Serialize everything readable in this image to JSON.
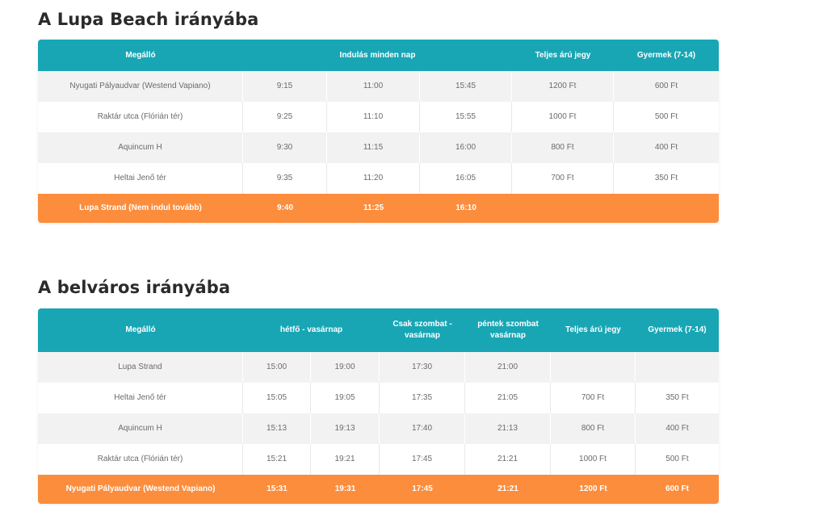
{
  "colors": {
    "header_bg": "#18a6b5",
    "final_row_bg": "#fc8d3c",
    "row_alt_bg": "#f2f2f2",
    "title": "#2b2b2b"
  },
  "to_beach": {
    "title": "A Lupa Beach irányába",
    "headers": {
      "stop": "Megálló",
      "departures": "Indulás minden nap",
      "full_price": "Teljes árú jegy",
      "child": "Gyermek (7-14)"
    },
    "rows": [
      {
        "stop": "Nyugati Pályaudvar (Westend Vapiano)",
        "t1": "9:15",
        "t2": "11:00",
        "t3": "15:45",
        "full": "1200 Ft",
        "child": "600 Ft"
      },
      {
        "stop": "Raktár utca (Flórián tér)",
        "t1": "9:25",
        "t2": "11:10",
        "t3": "15:55",
        "full": "1000 Ft",
        "child": "500 Ft"
      },
      {
        "stop": "Aquincum H",
        "t1": "9:30",
        "t2": "11:15",
        "t3": "16:00",
        "full": "800 Ft",
        "child": "400 Ft"
      },
      {
        "stop": "Heltai Jenő tér",
        "t1": "9:35",
        "t2": "11:20",
        "t3": "16:05",
        "full": "700 Ft",
        "child": "350 Ft"
      }
    ],
    "final": {
      "stop": "Lupa Strand (Nem indul tovább)",
      "t1": "9:40",
      "t2": "11:25",
      "t3": "16:10",
      "full": "",
      "child": ""
    }
  },
  "to_city": {
    "title": "A belváros irányába",
    "headers": {
      "stop": "Megálló",
      "mon_sun": "hétfő - vasárnap",
      "sat_sun_only": "Csak szombat - vasárnap",
      "fri_sat_sun": "péntek szombat vasárnap",
      "full_price": "Teljes árú jegy",
      "child": "Gyermek (7-14)"
    },
    "rows": [
      {
        "stop": "Lupa Strand",
        "t1": "15:00",
        "t2": "19:00",
        "t3": "17:30",
        "t4": "21:00",
        "full": "",
        "child": ""
      },
      {
        "stop": "Heltai Jenő tér",
        "t1": "15:05",
        "t2": "19:05",
        "t3": "17:35",
        "t4": "21:05",
        "full": "700 Ft",
        "child": "350 Ft"
      },
      {
        "stop": "Aquincum H",
        "t1": "15:13",
        "t2": "19:13",
        "t3": "17:40",
        "t4": "21:13",
        "full": "800 Ft",
        "child": "400 Ft"
      },
      {
        "stop": "Raktár utca (Flórián tér)",
        "t1": "15:21",
        "t2": "19:21",
        "t3": "17:45",
        "t4": "21:21",
        "full": "1000 Ft",
        "child": "500 Ft"
      }
    ],
    "final": {
      "stop": "Nyugati Pályaudvar (Westend Vapiano)",
      "t1": "15:31",
      "t2": "19:31",
      "t3": "17:45",
      "t4": "21:21",
      "full": "1200 Ft",
      "child": "600 Ft"
    }
  }
}
